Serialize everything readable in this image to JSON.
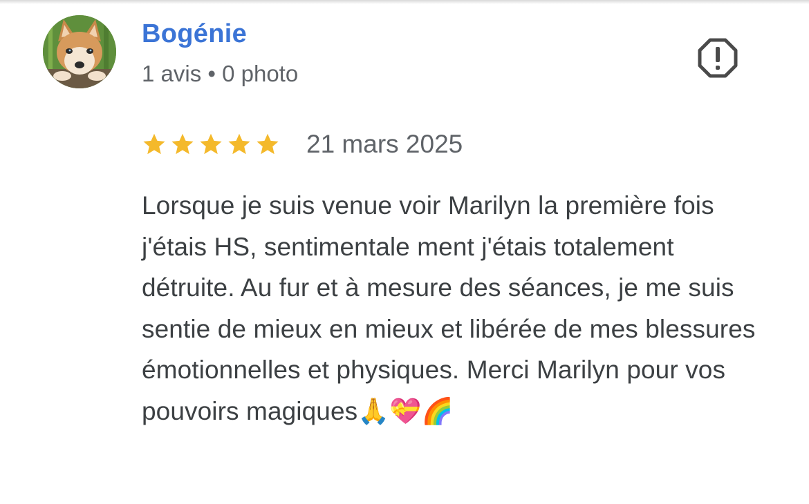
{
  "review": {
    "author_name": "Bogénie",
    "author_meta": "1 avis • 0 photo",
    "rating": 5,
    "rating_max": 5,
    "date": "21 mars 2025",
    "text": "Lorsque je suis venue voir Marilyn la première fois j'étais HS, sentimentale ment j'étais totalement détruite. Au fur et à mesure des séances, je me suis sentie de mieux en mieux et libérée de mes blessures émotionnelles et physiques. Merci Marilyn pour vos pouvoirs magiques🙏💝🌈"
  },
  "icons": {
    "avatar": "wolf-avatar",
    "report": "report-flag-octagon-icon",
    "star": "star-icon"
  },
  "colors": {
    "author_name": "#3b74d6",
    "star": "#f4b92b",
    "meta_text": "#5f6368",
    "body_text": "#3c4043",
    "report_icon": "#4a4a4a"
  }
}
